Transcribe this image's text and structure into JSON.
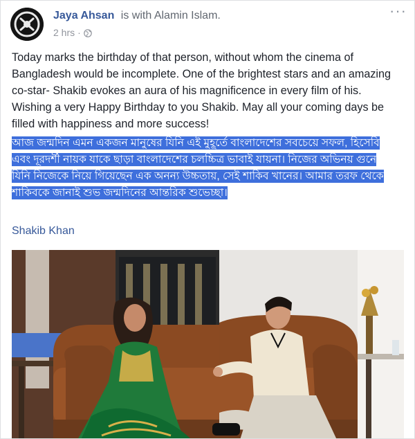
{
  "post": {
    "author": "Jaya Ahsan",
    "with_text": "is with",
    "tagged": "Alamin Islam",
    "separator": ".",
    "time": "2 hrs",
    "dot": "·",
    "more_icon": "more-options-icon",
    "privacy_icon": "globe-icon",
    "body_en": "Today marks the birthday of that person, without whom the cinema of Bangladesh would be incomplete. One of the brightest stars and an amazing co-star- Shakib evokes an aura of his magnificence in every film of his. Wishing a very Happy Birthday to you Shakib. May all your coming days be filled with happiness and more success!",
    "body_bn": "আজ জন্মদিন এমন একজন মানুষের যিনি এই মুহূর্তে বাংলাদেশের সবচেয়ে সফল, হিসেবি এবং দূরদর্শী নায়ক যাকে ছাড়া বাংলাদেশের চলচ্চিত্র ভাবাই যায়না। নিজের অভিনয় গুনে যিনি নিজেকে নিয়ে গিয়েছেন এক অনন্য উচ্চতায়, সেই শাকিব খানের। আমার তরফ থেকে শাকিবকে জানাই শুভ জন্মদিনের আন্তরিক শুভেচ্ছা।",
    "mention": "Shakib Khan",
    "highlight_color": "#3e6fdc",
    "link_color": "#365899"
  }
}
